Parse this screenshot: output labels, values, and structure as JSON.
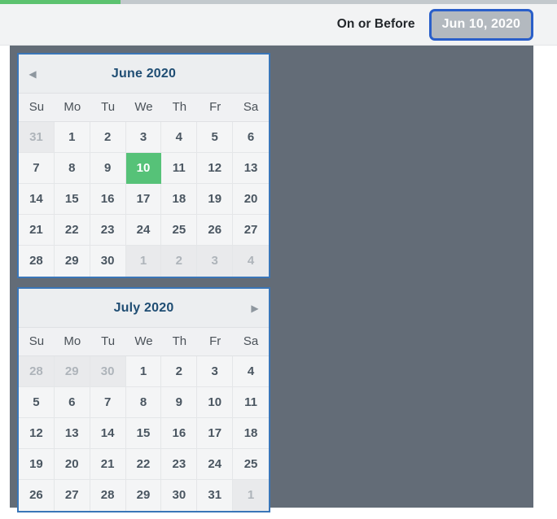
{
  "progress": {
    "percent": 21.6
  },
  "toolbar": {
    "operator_label": "On or Before",
    "date_value": "Jun 10, 2020",
    "accent_color": "#2a5fc9",
    "button_bg": "#b3b9bf"
  },
  "calendar": {
    "selected_color": "#56c278",
    "border_color": "#3a76b8",
    "backdrop_color": "#636c77",
    "weekdays": [
      "Su",
      "Mo",
      "Tu",
      "We",
      "Th",
      "Fr",
      "Sa"
    ],
    "months": [
      {
        "title": "June 2020",
        "prev_arrow": "◀",
        "next_arrow": "▶",
        "show_prev": true,
        "show_next": false,
        "weeks": [
          [
            {
              "label": "31",
              "state": "muted"
            },
            {
              "label": "1",
              "state": "normal"
            },
            {
              "label": "2",
              "state": "normal"
            },
            {
              "label": "3",
              "state": "normal"
            },
            {
              "label": "4",
              "state": "normal"
            },
            {
              "label": "5",
              "state": "normal"
            },
            {
              "label": "6",
              "state": "normal"
            }
          ],
          [
            {
              "label": "7",
              "state": "normal"
            },
            {
              "label": "8",
              "state": "normal"
            },
            {
              "label": "9",
              "state": "normal"
            },
            {
              "label": "10",
              "state": "selected"
            },
            {
              "label": "11",
              "state": "normal"
            },
            {
              "label": "12",
              "state": "normal"
            },
            {
              "label": "13",
              "state": "normal"
            }
          ],
          [
            {
              "label": "14",
              "state": "normal"
            },
            {
              "label": "15",
              "state": "normal"
            },
            {
              "label": "16",
              "state": "normal"
            },
            {
              "label": "17",
              "state": "normal"
            },
            {
              "label": "18",
              "state": "normal"
            },
            {
              "label": "19",
              "state": "normal"
            },
            {
              "label": "20",
              "state": "normal"
            }
          ],
          [
            {
              "label": "21",
              "state": "normal"
            },
            {
              "label": "22",
              "state": "normal"
            },
            {
              "label": "23",
              "state": "normal"
            },
            {
              "label": "24",
              "state": "normal"
            },
            {
              "label": "25",
              "state": "normal"
            },
            {
              "label": "26",
              "state": "normal"
            },
            {
              "label": "27",
              "state": "normal"
            }
          ],
          [
            {
              "label": "28",
              "state": "normal"
            },
            {
              "label": "29",
              "state": "normal"
            },
            {
              "label": "30",
              "state": "normal"
            },
            {
              "label": "1",
              "state": "muted"
            },
            {
              "label": "2",
              "state": "muted"
            },
            {
              "label": "3",
              "state": "muted"
            },
            {
              "label": "4",
              "state": "muted"
            }
          ]
        ]
      },
      {
        "title": "July 2020",
        "prev_arrow": "◀",
        "next_arrow": "▶",
        "show_prev": false,
        "show_next": true,
        "weeks": [
          [
            {
              "label": "28",
              "state": "muted"
            },
            {
              "label": "29",
              "state": "muted"
            },
            {
              "label": "30",
              "state": "muted"
            },
            {
              "label": "1",
              "state": "normal"
            },
            {
              "label": "2",
              "state": "normal"
            },
            {
              "label": "3",
              "state": "normal"
            },
            {
              "label": "4",
              "state": "normal"
            }
          ],
          [
            {
              "label": "5",
              "state": "normal"
            },
            {
              "label": "6",
              "state": "normal"
            },
            {
              "label": "7",
              "state": "normal"
            },
            {
              "label": "8",
              "state": "normal"
            },
            {
              "label": "9",
              "state": "normal"
            },
            {
              "label": "10",
              "state": "normal"
            },
            {
              "label": "11",
              "state": "normal"
            }
          ],
          [
            {
              "label": "12",
              "state": "normal"
            },
            {
              "label": "13",
              "state": "normal"
            },
            {
              "label": "14",
              "state": "normal"
            },
            {
              "label": "15",
              "state": "normal"
            },
            {
              "label": "16",
              "state": "normal"
            },
            {
              "label": "17",
              "state": "normal"
            },
            {
              "label": "18",
              "state": "normal"
            }
          ],
          [
            {
              "label": "19",
              "state": "normal"
            },
            {
              "label": "20",
              "state": "normal"
            },
            {
              "label": "21",
              "state": "normal"
            },
            {
              "label": "22",
              "state": "normal"
            },
            {
              "label": "23",
              "state": "normal"
            },
            {
              "label": "24",
              "state": "normal"
            },
            {
              "label": "25",
              "state": "normal"
            }
          ],
          [
            {
              "label": "26",
              "state": "normal"
            },
            {
              "label": "27",
              "state": "normal"
            },
            {
              "label": "28",
              "state": "normal"
            },
            {
              "label": "29",
              "state": "normal"
            },
            {
              "label": "30",
              "state": "normal"
            },
            {
              "label": "31",
              "state": "normal"
            },
            {
              "label": "1",
              "state": "muted"
            }
          ]
        ]
      }
    ]
  }
}
